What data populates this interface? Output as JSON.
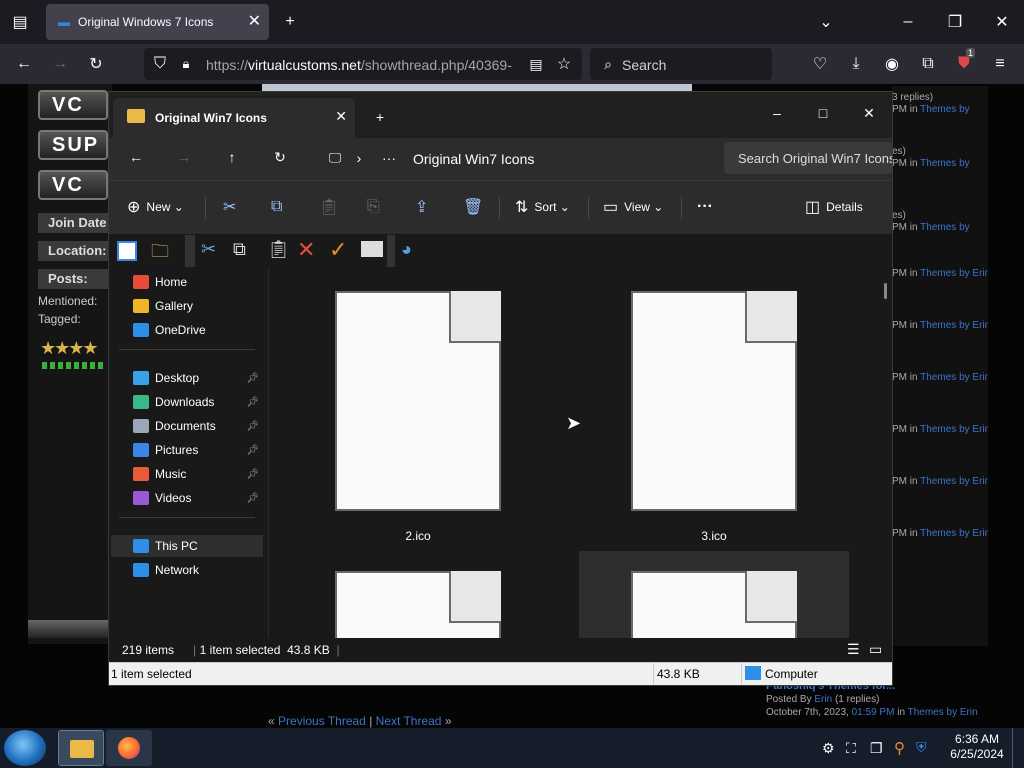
{
  "browser": {
    "tab_title": "Original Windows 7 Icons",
    "url_domain": "virtualcustoms.net",
    "url_prefix": "https://",
    "url_path": "/showthread.php/40369-",
    "search_placeholder": "Search",
    "extension_badge": "1"
  },
  "forum": {
    "logo_buttons": [
      "VC",
      "SUP",
      "VC"
    ],
    "labels": [
      "Join Date",
      "Location:",
      "Posts:"
    ],
    "mentioned": "Mentioned:",
    "tagged": "Tagged:",
    "prev_thread": "Previous Thread",
    "next_thread": "Next Thread",
    "nav_left": "«",
    "nav_sep": "|",
    "nav_right": "»",
    "rside": [
      {
        "top": "3 replies)",
        "bottom_dim": "PM in",
        "bottom_link": "Themes by"
      },
      {
        "top": "es)",
        "bottom_dim": "PM in",
        "bottom_link": "Themes by"
      },
      {
        "top": "es)",
        "bottom_dim": "PM in",
        "bottom_link": "Themes by"
      },
      {
        "top": "",
        "bottom_dim": "PM in",
        "bottom_link": "Themes by Erin"
      },
      {
        "top": "",
        "bottom_dim": "PM in",
        "bottom_link": "Themes by Erin"
      },
      {
        "top": "",
        "bottom_dim": "PM in",
        "bottom_link": "Themes by Erin"
      },
      {
        "top": "",
        "bottom_dim": "PM in",
        "bottom_link": "Themes by Erin"
      },
      {
        "top": "",
        "bottom_dim": "PM in",
        "bottom_link": "Themes by Erin"
      },
      {
        "top": "",
        "bottom_dim": "PM in",
        "bottom_link": "Themes by Erin"
      }
    ],
    "recent_post": {
      "title": "Panoshiq's Themes for...",
      "posted_by": "Posted By",
      "author": "Erin",
      "replies": "(1 replies)",
      "date": "October 7th, 2023,",
      "time": "01:59 PM",
      "in": "in",
      "forum": "Themes by Erin"
    }
  },
  "explorer": {
    "tab_title": "Original Win7 Icons",
    "path": "Original Win7 Icons",
    "search_placeholder": "Search Original Win7 Icons",
    "commands": {
      "new": "New",
      "sort": "Sort",
      "view": "View",
      "more": "···",
      "details": "Details"
    },
    "nav_items": [
      {
        "label": "Home",
        "icon": "home-icon",
        "color": "#e74c3c",
        "pinned": false
      },
      {
        "label": "Gallery",
        "icon": "gallery-icon",
        "color": "#f0b429",
        "pinned": false
      },
      {
        "label": "OneDrive",
        "icon": "cloud-icon",
        "color": "#2e8fe8",
        "pinned": false
      },
      {
        "label": "Desktop",
        "icon": "desktop-icon",
        "color": "#3aa0e8",
        "pinned": true
      },
      {
        "label": "Downloads",
        "icon": "download-icon",
        "color": "#3bb88a",
        "pinned": true
      },
      {
        "label": "Documents",
        "icon": "document-icon",
        "color": "#9aa7b8",
        "pinned": true
      },
      {
        "label": "Pictures",
        "icon": "pictures-icon",
        "color": "#3a86e8",
        "pinned": true
      },
      {
        "label": "Music",
        "icon": "music-icon",
        "color": "#e85c3a",
        "pinned": true
      },
      {
        "label": "Videos",
        "icon": "videos-icon",
        "color": "#9b59d6",
        "pinned": true
      },
      {
        "label": "This PC",
        "icon": "computer-icon",
        "color": "#2e8fe8",
        "pinned": false,
        "selected": true
      },
      {
        "label": "Network",
        "icon": "network-icon",
        "color": "#2e8fe8",
        "pinned": false
      }
    ],
    "files": [
      "2.ico",
      "3.ico",
      "",
      ""
    ],
    "status": {
      "count": "219 items",
      "selected": "1 item selected",
      "size": "43.8 KB"
    },
    "bottom_bar": {
      "selected": "1 item selected",
      "size": "43.8 KB",
      "location": "Computer"
    }
  },
  "taskbar": {
    "time": "6:36 AM",
    "date": "6/25/2024"
  }
}
